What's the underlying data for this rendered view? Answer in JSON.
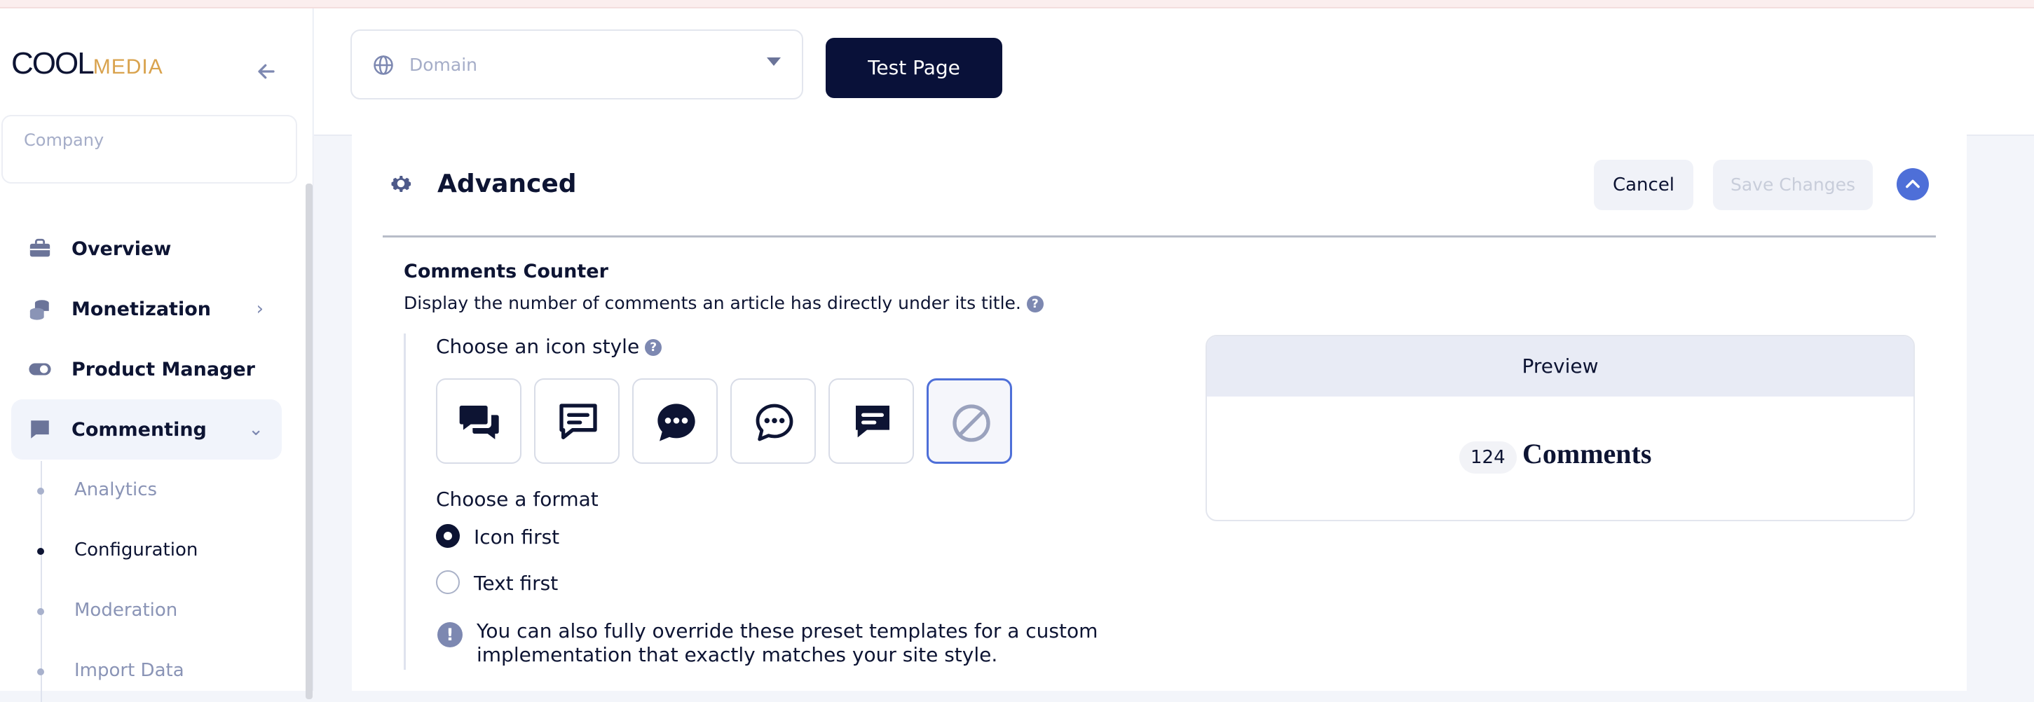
{
  "sidebar": {
    "logo": {
      "part1": "COOL",
      "part2": "MEDIA"
    },
    "company_placeholder": "Company",
    "items": [
      {
        "label": "Overview",
        "icon": "briefcase-icon"
      },
      {
        "label": "Monetization",
        "icon": "coins-icon"
      },
      {
        "label": "Product Manager",
        "icon": "toggle-icon"
      },
      {
        "label": "Commenting",
        "icon": "comment-icon"
      }
    ],
    "subitems": [
      {
        "label": "Analytics"
      },
      {
        "label": "Configuration"
      },
      {
        "label": "Moderation"
      },
      {
        "label": "Import Data"
      }
    ]
  },
  "topbar": {
    "domain_placeholder": "Domain",
    "test_button": "Test Page"
  },
  "card": {
    "title": "Advanced",
    "cancel": "Cancel",
    "save": "Save Changes",
    "section_title": "Comments Counter",
    "section_desc": "Display the number of comments an article has directly under its title.",
    "choose_icon": "Choose an icon style",
    "icon_styles": [
      "two-bubbles-icon",
      "square-lines-bubble-icon",
      "round-dots-solid-icon",
      "round-dots-outline-icon",
      "square-lines-solid-icon",
      "none-icon"
    ],
    "choose_format": "Choose a format",
    "formats": [
      "Icon first",
      "Text first"
    ],
    "note": "You can also fully override these preset templates for a custom implementation that exactly matches your site style.",
    "preview": {
      "title": "Preview",
      "count": "124",
      "word": "Comments"
    }
  },
  "colors": {
    "accent": "#4e6fd8",
    "primary": "#091139"
  }
}
